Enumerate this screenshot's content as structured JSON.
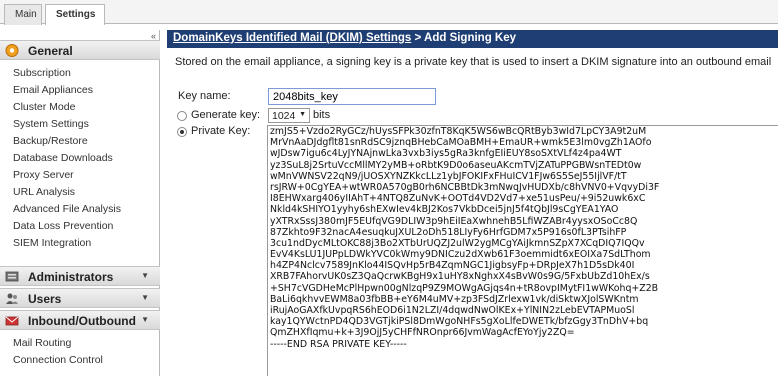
{
  "tabs": {
    "main": "Main",
    "settings": "Settings"
  },
  "sidebar": {
    "collapse_icon": "«",
    "general": {
      "label": "General",
      "items": [
        "Subscription",
        "Email Appliances",
        "Cluster Mode",
        "System Settings",
        "Backup/Restore",
        "Database Downloads",
        "Proxy Server",
        "URL Analysis",
        "Advanced File Analysis",
        "Data Loss Prevention",
        "SIEM Integration"
      ]
    },
    "administrators": {
      "label": "Administrators"
    },
    "users": {
      "label": "Users"
    },
    "inbound_outbound": {
      "label": "Inbound/Outbound",
      "items": [
        "Mail Routing",
        "Connection Control"
      ]
    }
  },
  "breadcrumb": {
    "link": "DomainKeys Identified Mail (DKIM) Settings",
    "separator": " > ",
    "current": "Add Signing Key"
  },
  "description": "Stored on the email appliance, a signing key is a private key that is used to insert a DKIM signature into an outbound email",
  "form": {
    "key_name_label": "Key name:",
    "key_name_value": "2048bits_key",
    "generate_key_label": "Generate key:",
    "bits_value": "1024",
    "bits_unit": "bits",
    "private_key_label": "Private Key:",
    "private_key_selected": true,
    "private_key_lines": [
      "zmJS5+Vzdo2RyGCz/hUysSFPk30zfnT8KqK5WS6wBcQRtByb3wId7LpCY3A9t2uM",
      "MrVnAaDJdgflt81snRdSC9jznqBHebCaMOaBMH+EmaUR+wmk5E3lm0vgZh1AOfo",
      "wJDsw7igu6c4LyJYNAjnwLka3vxb3iys5gRa3knfgEIiEUY8soSXtVLf4z4pa4WT",
      "yz3SuL8j2SrtuVccMllMY2yMB+oRbtK9D0o6aseuAKcmTVjZATuPPGBWsnTEDt0w",
      "wMnVWNSV22qN9/jUOSXYNZKkcLLz1ybJFOKIFxFHuICV1FJw6S5SeJ55IjlVF/tT",
      "rsJRW+0CgYEA+wtWR0A570gB0rh6NCBBtDk3mNwqJvHUDXb/c8hVNV0+VqvyDi3F",
      "I8EHWxarg406yIIAhT+4NTQ8ZuNvK+OOTd4VD2Vd7+xe51usPeu/+9i52uwk6xC",
      "Nkld4kSHIYO1yyhy6shEXwIev4kBJ2Kos7VkbDcei5jnJ5f4tQbJl9sCgYEA1YAO",
      "yXTRxSssJ380mJF5EUfqVG9DLIW3p9hEiIEaXwhnehB5LfiWZABr4yysxOSoCc8Q",
      "87Zkhto9F32nacA4esuqkuJXUL2oDh518LIyFy6HrfGDM7x5P916s0fL3PTsihFP",
      "3cu1ndDycMLtOKC88j3Bo2XTbUrUQZJ2ulW2ygMCgYAiJkmnSZpX7XCqDIQ7IQQv",
      "EvV4KsLU1JUPpLDWkYVC0kWmy9DNICzu2dXwb61F3oemmidt6xEOIXa7SdLThom",
      "h4ZP4Nclcv7589JnKlo44ISQvHp5rB4ZqmNGC1JigbsyFp+DRpJeX7h1D5sDk40I",
      "XRB7FAhorvUK0sZ3QaQcrwKBgH9x1uHY8xNghxX4sBvW0s9G/5FxbUbZd10hEx/s",
      "+SH7cVGDHeMcPlHpwn00gNlzqP9Z9MOWgAGjqs4n+tR8ovpIMytFI1wWKohq+Z2B",
      "BaLi6qkhvvEWM8a03fbBB+eY6M4uMV+zp3FSdJZrlexw1vk/diSktwXJolSWKntm",
      "iRujAoGAXfkUvpqRS6hEOD6i1N2LZI/4dqwdNwOlKEx+YlNIN2zLebEVTAPMuoSl",
      "kay1QYWctnPD4QD3VGTjkiPSl8DmWgoNHFs5gXoLlfeDWETk/bfzGgy3TnDhV+bq",
      "QmZHXfIqmu+k+3J9OjJ5yCHFfNROnpr66JvmWagAcfEYoYjy2ZQ=",
      "-----END RSA PRIVATE KEY-----"
    ]
  },
  "colors": {
    "breadcrumb_bg": "#1f3e73",
    "input_border": "#7a9cd3"
  },
  "icons": {
    "general": "gear-icon",
    "administrators": "admin-icon",
    "users": "users-icon",
    "inbound_outbound": "mail-icon",
    "chevron": "chevron-down-icon"
  }
}
